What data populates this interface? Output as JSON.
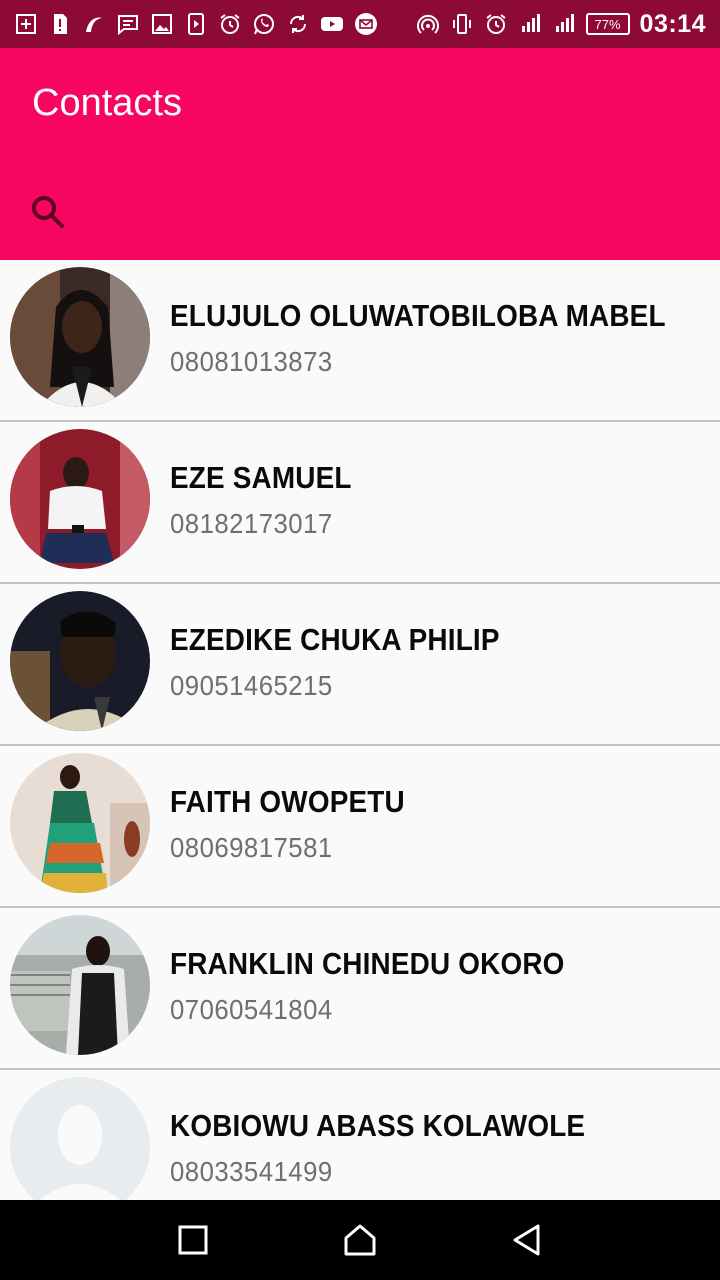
{
  "status_bar": {
    "left_icons": [
      "add-box-icon",
      "sim-alert-icon",
      "hotspot-icon",
      "message-icon",
      "gallery-icon",
      "video-icon",
      "alarm-icon",
      "whatsapp-icon",
      "sync-icon",
      "youtube-icon",
      "mail-icon"
    ],
    "right_icons": [
      "hotspot-signal-icon",
      "vibrate-icon",
      "alarm-icon",
      "signal-3g-icon",
      "signal-icon"
    ],
    "battery": "77%",
    "time": "03:14"
  },
  "app_bar": {
    "title": "Contacts"
  },
  "search": {
    "placeholder": ""
  },
  "contacts": [
    {
      "name": "ELUJULO OLUWATOBILOBA MABEL",
      "phone": "08081013873"
    },
    {
      "name": "EZE SAMUEL",
      "phone": "08182173017"
    },
    {
      "name": "EZEDIKE CHUKA PHILIP",
      "phone": "09051465215"
    },
    {
      "name": "FAITH OWOPETU",
      "phone": "08069817581"
    },
    {
      "name": "FRANKLIN CHINEDU OKORO",
      "phone": "07060541804"
    },
    {
      "name": "KOBIOWU ABASS KOLAWOLE",
      "phone": "08033541499"
    }
  ],
  "colors": {
    "primary": "#f60561",
    "status_bar": "#8c0a35",
    "divider": "#c2c2c2",
    "phone_text": "#6f6f6f"
  },
  "nav_bar": [
    "recents-icon",
    "home-icon",
    "back-icon"
  ]
}
